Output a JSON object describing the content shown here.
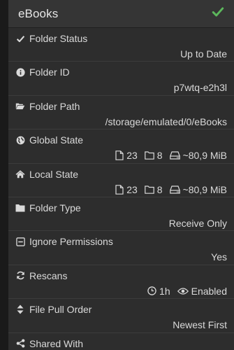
{
  "header": {
    "title": "eBooks",
    "status_icon": "check-icon",
    "status_color": "#5cb85c"
  },
  "rows": {
    "folder_status": {
      "label": "Folder Status",
      "icon": "check-icon",
      "value": "Up to Date"
    },
    "folder_id": {
      "label": "Folder ID",
      "icon": "info-circle-icon",
      "value": "p7wtq-e2h3l"
    },
    "folder_path": {
      "label": "Folder Path",
      "icon": "folder-open-icon",
      "value": "/storage/emulated/0/eBooks"
    },
    "global_state": {
      "label": "Global State",
      "icon": "globe-icon",
      "files": "23",
      "folders": "8",
      "size": "~80,9 MiB"
    },
    "local_state": {
      "label": "Local State",
      "icon": "home-icon",
      "files": "23",
      "folders": "8",
      "size": "~80,9 MiB"
    },
    "folder_type": {
      "label": "Folder Type",
      "icon": "folder-icon",
      "value": "Receive Only"
    },
    "ignore_permissions": {
      "label": "Ignore Permissions",
      "icon": "minus-square-icon",
      "value": "Yes"
    },
    "rescans": {
      "label": "Rescans",
      "icon": "refresh-icon",
      "interval": "1h",
      "watcher": "Enabled"
    },
    "file_pull_order": {
      "label": "File Pull Order",
      "icon": "sort-icon",
      "value": "Newest First"
    },
    "shared_with": {
      "label": "Shared With",
      "icon": "share-alt-icon"
    }
  }
}
